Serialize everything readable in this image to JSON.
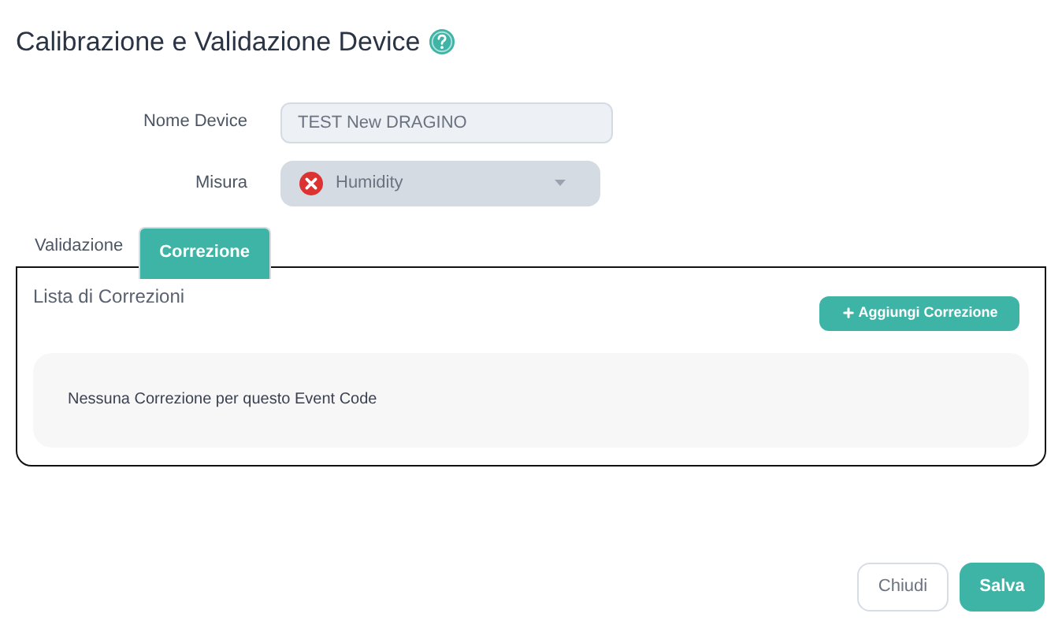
{
  "title": "Calibrazione e Validazione Device",
  "fields": [
    {
      "kind": "text",
      "label": "Nome Device",
      "value": "TEST New DRAGINO"
    },
    {
      "kind": "select",
      "label": "Misura",
      "value": "Humidity"
    }
  ],
  "tabs": [
    {
      "label": "Validazione",
      "selected": false
    },
    {
      "label": "Correzione",
      "selected": true
    }
  ],
  "panel": {
    "heading": "Lista di Correzioni",
    "add_button": "Aggiungi Correzione",
    "empty_message": "Nessuna Correzione per questo Event Code"
  },
  "buttons": [
    {
      "label": "Chiudi",
      "kind": "secondary"
    },
    {
      "label": "Salva",
      "kind": "primary"
    }
  ]
}
